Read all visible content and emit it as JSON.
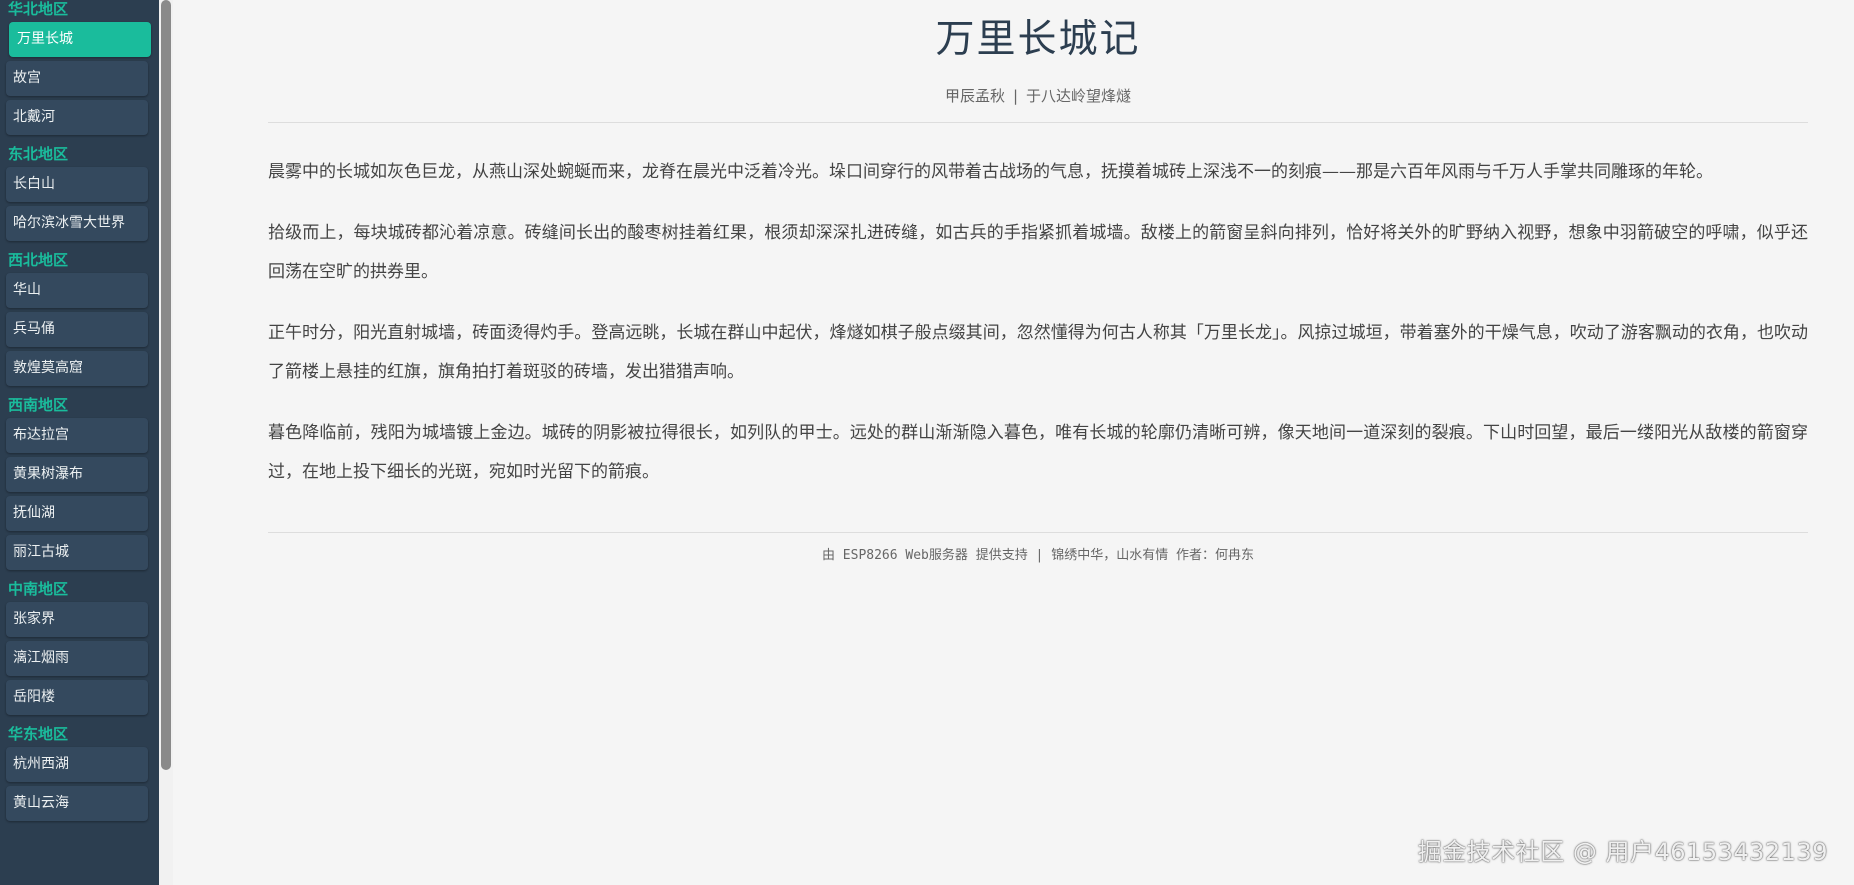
{
  "sidebar": {
    "groups": [
      {
        "title": "华北地区",
        "items": [
          "万里长城",
          "故宫",
          "北戴河"
        ]
      },
      {
        "title": "东北地区",
        "items": [
          "长白山",
          "哈尔滨冰雪大世界"
        ]
      },
      {
        "title": "西北地区",
        "items": [
          "华山",
          "兵马俑",
          "敦煌莫高窟"
        ]
      },
      {
        "title": "西南地区",
        "items": [
          "布达拉宫",
          "黄果树瀑布",
          "抚仙湖",
          "丽江古城"
        ]
      },
      {
        "title": "中南地区",
        "items": [
          "张家界",
          "漓江烟雨",
          "岳阳楼"
        ]
      },
      {
        "title": "华东地区",
        "items": [
          "杭州西湖",
          "黄山云海"
        ]
      }
    ],
    "active_item": "万里长城"
  },
  "article": {
    "title": "万里长城记",
    "meta_date": "甲辰孟秋",
    "meta_sep": "|",
    "meta_place": "于八达岭望烽燧",
    "paragraphs": [
      "晨雾中的长城如灰色巨龙，从燕山深处蜿蜒而来，龙脊在晨光中泛着冷光。垛口间穿行的风带着古战场的气息，抚摸着城砖上深浅不一的刻痕——那是六百年风雨与千万人手掌共同雕琢的年轮。",
      "拾级而上，每块城砖都沁着凉意。砖缝间长出的酸枣树挂着红果，根须却深深扎进砖缝，如古兵的手指紧抓着城墙。敌楼上的箭窗呈斜向排列，恰好将关外的旷野纳入视野，想象中羽箭破空的呼啸，似乎还回荡在空旷的拱券里。",
      "正午时分，阳光直射城墙，砖面烫得灼手。登高远眺，长城在群山中起伏，烽燧如棋子般点缀其间，忽然懂得为何古人称其「万里长龙」。风掠过城垣，带着塞外的干燥气息，吹动了游客飘动的衣角，也吹动了箭楼上悬挂的红旗，旗角拍打着斑驳的砖墙，发出猎猎声响。",
      "暮色降临前，残阳为城墙镀上金边。城砖的阴影被拉得很长，如列队的甲士。远处的群山渐渐隐入暮色，唯有长城的轮廓仍清晰可辨，像天地间一道深刻的裂痕。下山时回望，最后一缕阳光从敌楼的箭窗穿过，在地上投下细长的光斑，宛如时光留下的箭痕。"
    ]
  },
  "footer": {
    "text": "由 ESP8266 Web服务器 提供支持 | 锦绣中华，山水有情 作者：何冉东"
  },
  "watermark": {
    "text": "掘金技术社区 @ 用户46153432139"
  },
  "colors": {
    "sidebar_bg": "#2c3e50",
    "nav_item_bg": "#34495e",
    "accent": "#1abc9c",
    "page_bg": "#f5f5f5"
  }
}
